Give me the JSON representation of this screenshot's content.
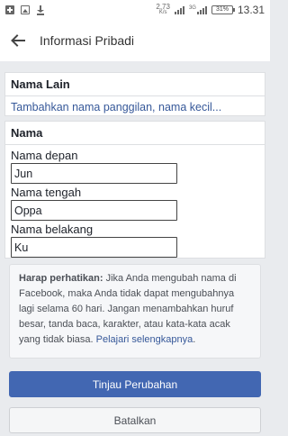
{
  "status_bar": {
    "net_speed_value": "2,73",
    "net_speed_unit": "K/s",
    "network_label": "3G",
    "battery": "31%",
    "time": "13.31"
  },
  "app_bar": {
    "title": "Informasi Pribadi"
  },
  "other_names": {
    "header": "Nama Lain",
    "add_link": "Tambahkan nama panggilan, nama kecil..."
  },
  "name": {
    "header": "Nama",
    "first": {
      "label": "Nama depan",
      "value": "Jun"
    },
    "middle": {
      "label": "Nama tengah",
      "value": "Oppa"
    },
    "last": {
      "label": "Nama belakang",
      "value": "Ku"
    }
  },
  "notice": {
    "bold": "Harap perhatikan:",
    "body": " Jika Anda mengubah nama di Facebook, maka Anda tidak dapat mengubahnya lagi selama 60 hari. Jangan menambahkan huruf besar, tanda baca, karakter, atau kata-kata acak yang tidak biasa. ",
    "link": "Pelajari selengkapnya",
    "end": "."
  },
  "buttons": {
    "review": "Tinjau Perubahan",
    "cancel": "Batalkan"
  },
  "colors": {
    "accent": "#4267b2",
    "link": "#365899",
    "background": "#e9ebee"
  }
}
